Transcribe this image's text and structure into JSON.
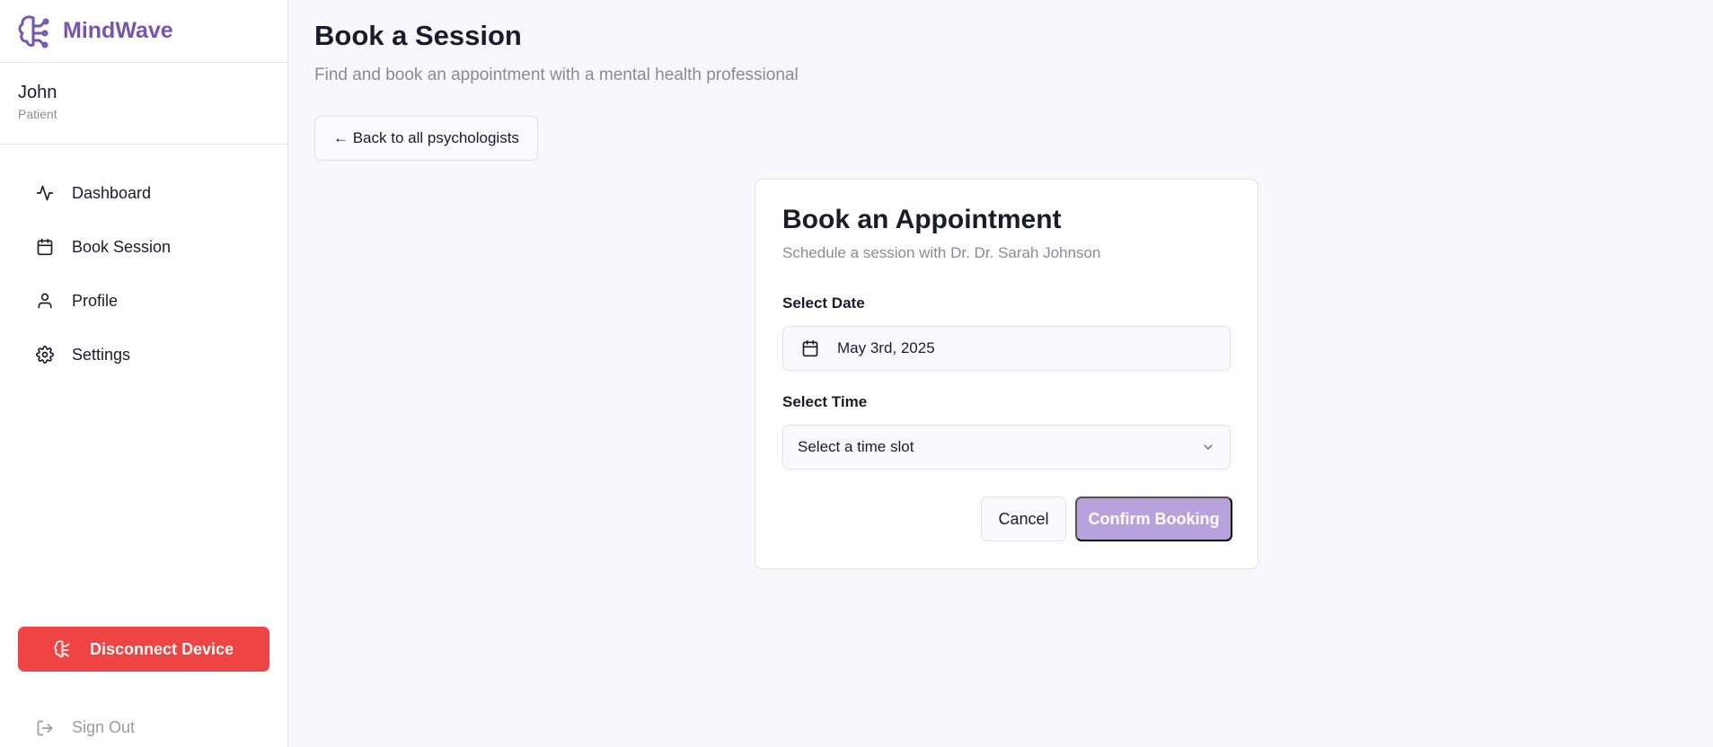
{
  "app": {
    "name": "MindWave"
  },
  "user": {
    "name": "John",
    "role": "Patient"
  },
  "nav": [
    {
      "label": "Dashboard",
      "icon": "activity-icon"
    },
    {
      "label": "Book Session",
      "icon": "calendar-icon"
    },
    {
      "label": "Profile",
      "icon": "user-icon"
    },
    {
      "label": "Settings",
      "icon": "gear-icon"
    }
  ],
  "sidebar_footer": {
    "disconnect_label": "Disconnect Device",
    "signout_label": "Sign Out"
  },
  "page": {
    "title": "Book a Session",
    "subtitle": "Find and book an appointment with a mental health professional",
    "back_label": "← Back to all psychologists"
  },
  "booking": {
    "title": "Book an Appointment",
    "subtitle": "Schedule a session with Dr. Dr. Sarah Johnson",
    "date_label": "Select Date",
    "date_value": "May 3rd, 2025",
    "time_label": "Select Time",
    "time_placeholder": "Select a time slot",
    "cancel_label": "Cancel",
    "confirm_label": "Confirm Booking"
  },
  "colors": {
    "brand": "#7656ad",
    "danger": "#ef4444",
    "confirm_disabled": "#b8a2dd",
    "background": "#f8f7fd"
  }
}
